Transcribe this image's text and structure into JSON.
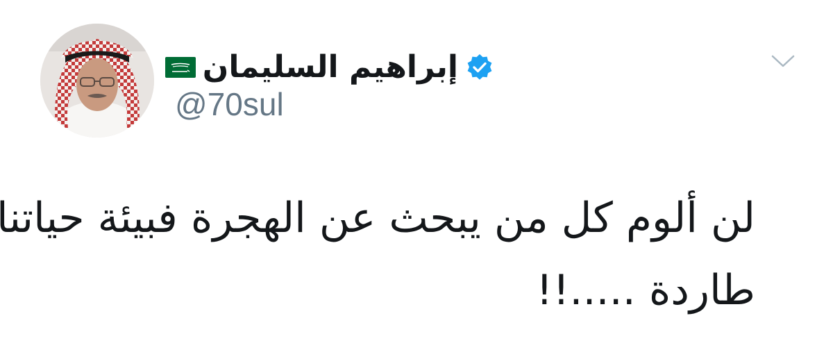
{
  "author": {
    "display_name": "إبراهيم السليمان",
    "handle": "@70sul",
    "verified": true,
    "flag": "saudi-arabia-flag-emoji",
    "avatar": "profile-photo"
  },
  "tweet": {
    "lines": [
      "لن ألوم كل من يبحث عن الهجرة فبيئة حياتنا",
      "طاردة .....!!"
    ]
  },
  "menu": {
    "icon": "chevron-down-icon"
  },
  "colors": {
    "text": "#14171a",
    "secondary": "#657786",
    "verified_blue": "#1da1f2",
    "flag_green": "#006c35",
    "chevron": "#aab8c2"
  }
}
